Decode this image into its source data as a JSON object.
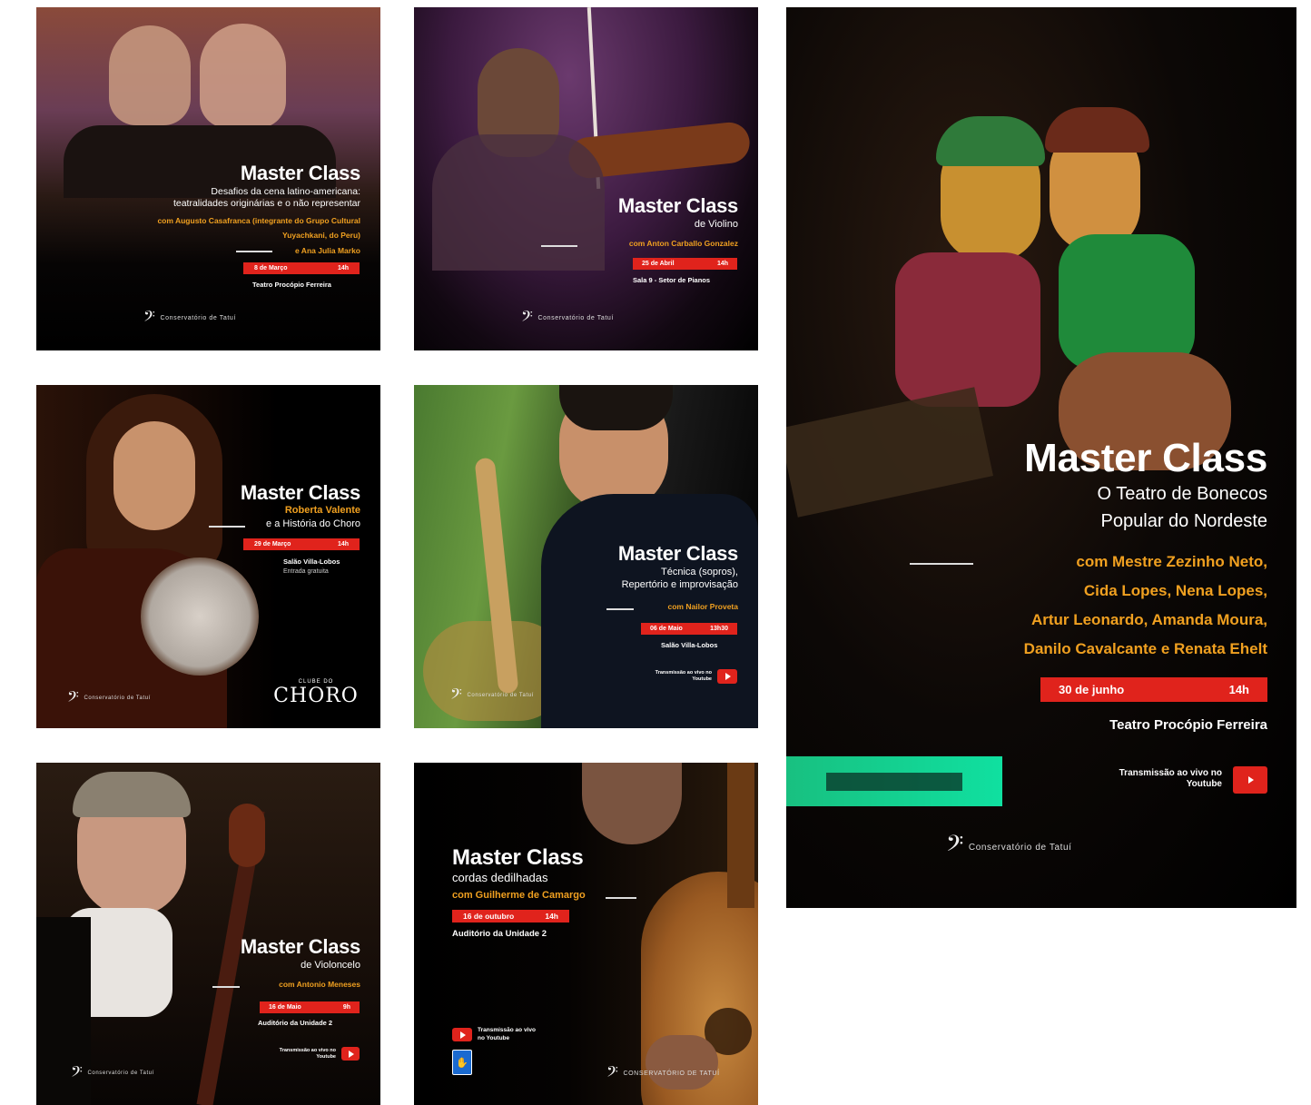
{
  "cards": [
    {
      "title": "Master Class",
      "subtitle_1": "Desafios da cena latino-americana:",
      "subtitle_2": "teatralidades originárias e o não representar",
      "with_1": "com Augusto Casafranca (integrante do Grupo Cultural",
      "with_2": "Yuyachkani, do Peru)",
      "with_3": "e Ana Julia Marko",
      "date": "8 de Março",
      "time": "14h",
      "venue": "Teatro Procópio Ferreira",
      "logo": "Conservatório de Tatuí"
    },
    {
      "title": "Master Class",
      "subtitle_1": "de Violino",
      "with_1": "com Anton Carballo Gonzalez",
      "date": "25 de Abril",
      "time": "14h",
      "venue": "Sala 9 - Setor de Pianos",
      "logo": "Conservatório de Tatuí"
    },
    {
      "title": "Master Class",
      "subtitle_1": "Roberta Valente",
      "subtitle_2": "e a História do Choro",
      "date": "29 de Março",
      "time": "14h",
      "venue": "Salão Villa-Lobos",
      "note": "Entrada gratuita",
      "logo": "Conservatório de Tatuí",
      "partner_logo": "CHORO",
      "partner_tag": "CLUBE DO"
    },
    {
      "title": "Master Class",
      "subtitle_1": "Técnica (sopros),",
      "subtitle_2": "Repertório e improvisação",
      "with_1": "com Nailor Proveta",
      "date": "06 de Maio",
      "time": "13h30",
      "venue": "Salão Villa-Lobos",
      "stream": "Transmissão ao vivo no Youtube",
      "logo": "Conservatório de Tatuí"
    },
    {
      "title": "Master Class",
      "subtitle_1": "de Violoncelo",
      "with_1": "com Antonio Meneses",
      "date": "16 de Maio",
      "time": "9h",
      "venue": "Auditório da Unidade 2",
      "stream": "Transmissão ao vivo no Youtube",
      "logo": "Conservatório de Tatuí"
    },
    {
      "title": "Master Class",
      "subtitle_1": "cordas dedilhadas",
      "with_1": "com Guilherme de Camargo",
      "date": "16 de outubro",
      "time": "14h",
      "venue": "Auditório da Unidade 2",
      "stream_1": "Transmissão ao vivo",
      "stream_2": "no Youtube",
      "logo": "Conservatório de Tatuí"
    },
    {
      "title": "Master Class",
      "subtitle_1": "O Teatro de Bonecos",
      "subtitle_2": "Popular do Nordeste",
      "with_1": "com Mestre Zezinho Neto,",
      "with_2": "Cida Lopes, Nena Lopes,",
      "with_3": "Artur Leonardo, Amanda Moura,",
      "with_4": "Danilo Cavalcante e Renata Ehelt",
      "date": "30 de junho",
      "time": "14h",
      "venue": "Teatro Procópio Ferreira",
      "stream": "Transmissão ao vivo no Youtube",
      "logo": "Conservatório de Tatuí"
    }
  ]
}
